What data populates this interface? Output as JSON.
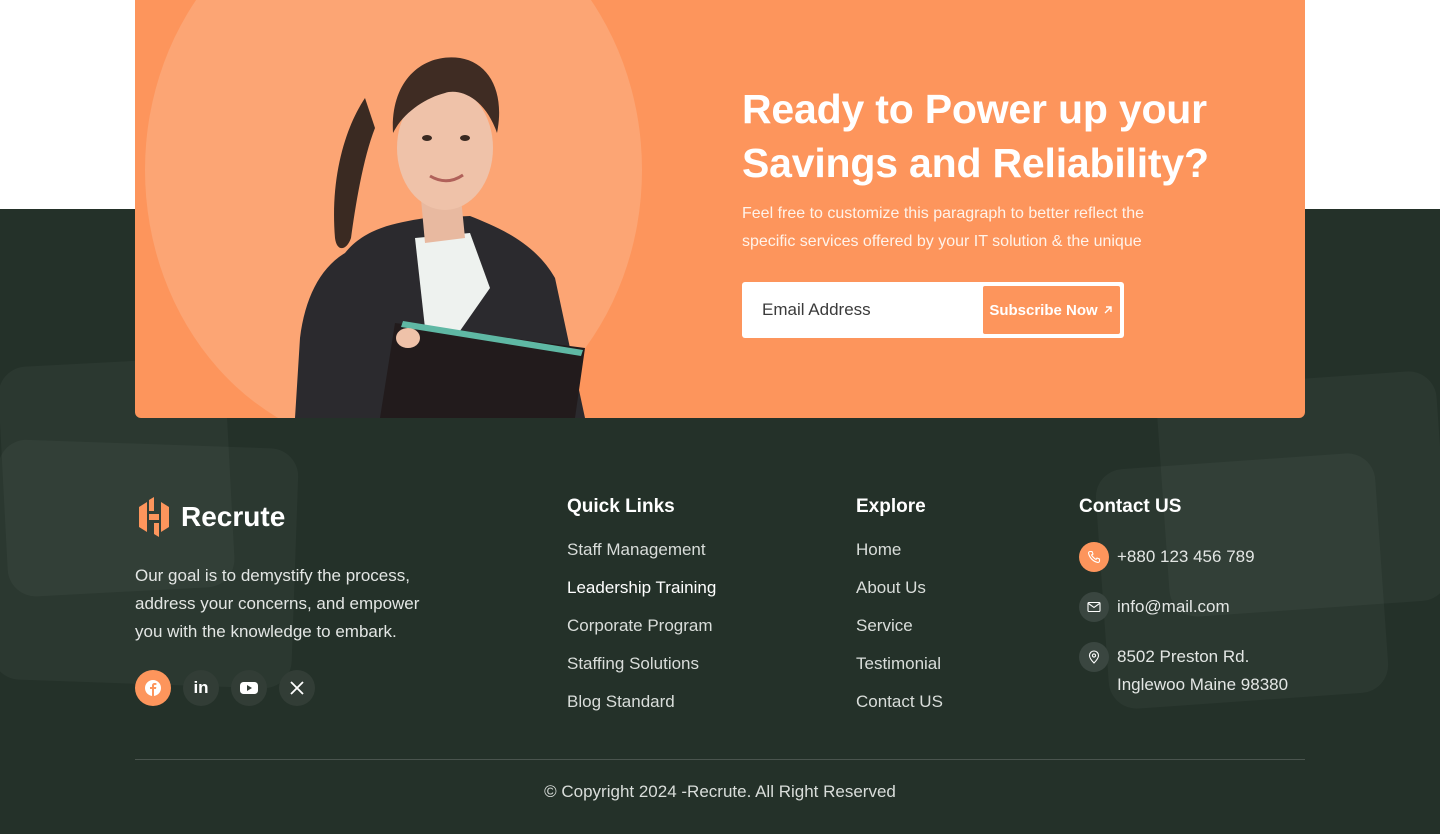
{
  "cta": {
    "title_line1": "Ready to Power up your",
    "title_line2": "Savings and Reliability?",
    "paragraph_line1": "Feel free to customize this paragraph to better reflect the",
    "paragraph_line2": "specific services offered by your IT solution & the unique",
    "email_placeholder": "Email Address",
    "subscribe_label": "Subscribe Now",
    "subscribe_icon": "arrow-up-right-icon"
  },
  "brand": {
    "name": "Recrute",
    "about_line1": "Our goal is to demystify the process,",
    "about_line2": "address your concerns, and empower",
    "about_line3": "you with the knowledge to embark."
  },
  "socials": [
    {
      "icon": "facebook-icon"
    },
    {
      "icon": "linkedin-icon",
      "text": "in"
    },
    {
      "icon": "youtube-icon"
    },
    {
      "icon": "x-twitter-icon"
    }
  ],
  "quick_links": {
    "title": "Quick Links",
    "items": [
      "Staff Management",
      "Leadership Training",
      "Corporate Program",
      "Staffing Solutions",
      "Blog Standard"
    ]
  },
  "explore": {
    "title": "Explore",
    "items": [
      "Home",
      "About Us",
      "Service",
      "Testimonial",
      "Contact US"
    ]
  },
  "contact": {
    "title": "Contact US",
    "phone": "+880 123 456 789",
    "email": "info@mail.com",
    "address_line1": "8502 Preston Rd.",
    "address_line2": "Inglewoo Maine 98380"
  },
  "colors": {
    "accent": "#fd955c",
    "footer_bg": "#243129"
  },
  "copyright": "© Copyright 2024 -Recrute. All Right Reserved"
}
